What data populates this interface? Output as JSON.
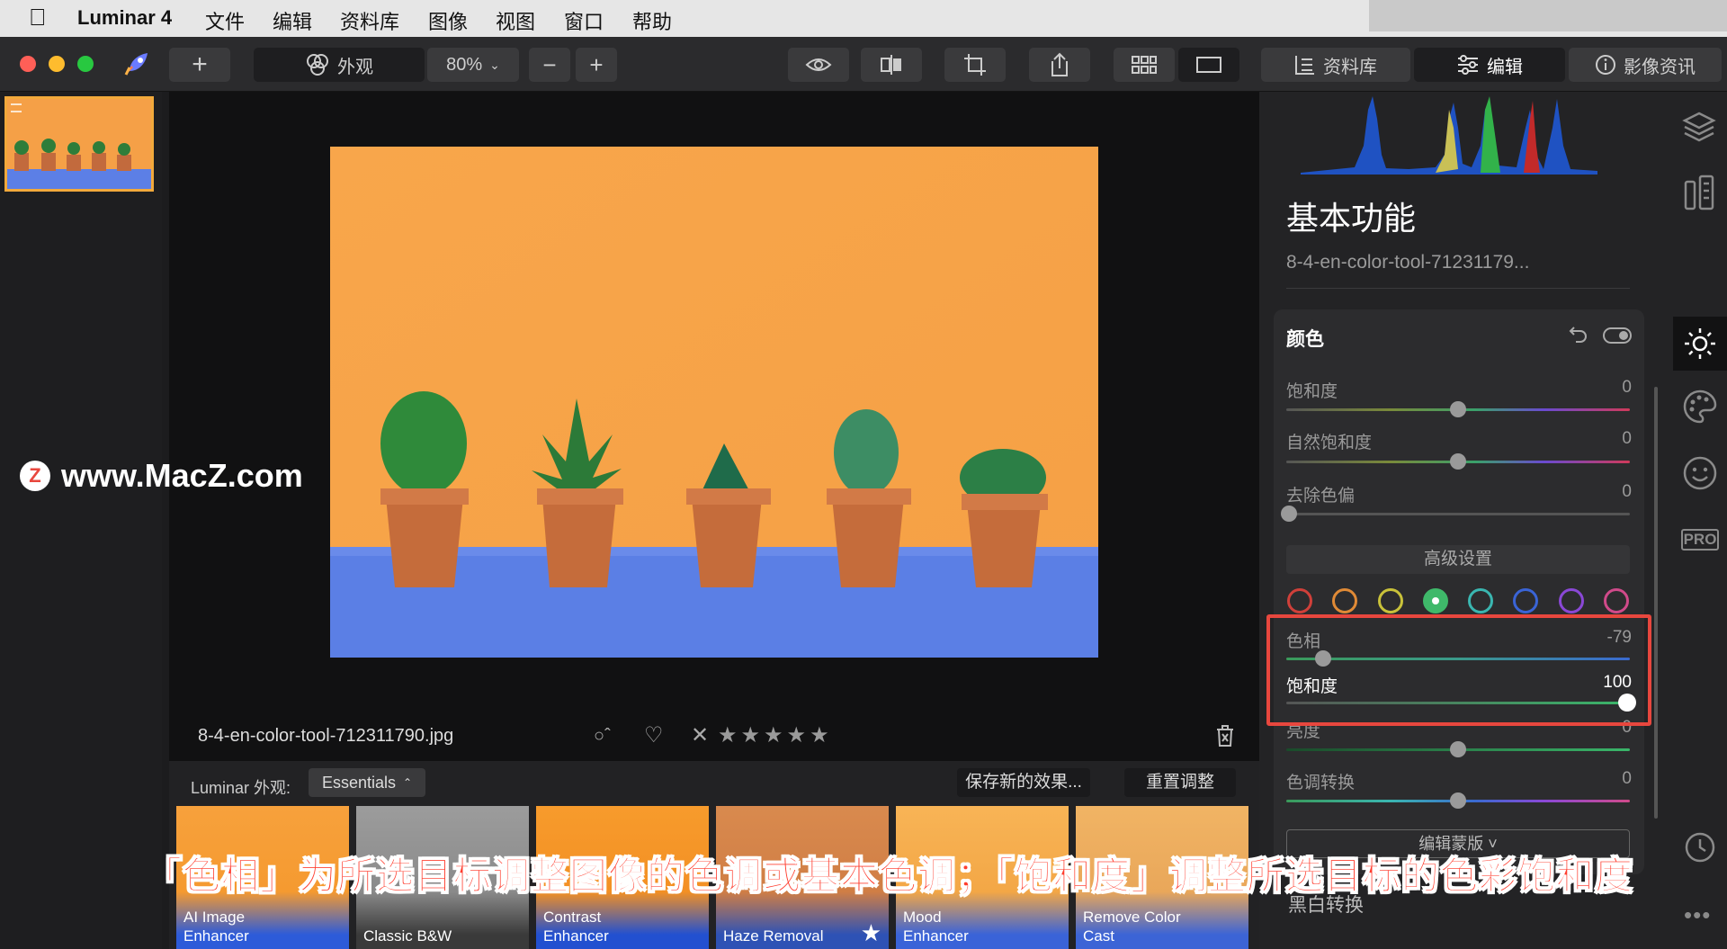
{
  "menubar": {
    "app_name": "Luminar 4",
    "items": [
      "文件",
      "编辑",
      "资料库",
      "图像",
      "视图",
      "窗口",
      "帮助"
    ]
  },
  "toolbar": {
    "add_label": "+",
    "looks_label": "外观",
    "zoom_label": "80%",
    "zoom_out_label": "−",
    "zoom_in_label": "+",
    "tab_library": "资料库",
    "tab_edit": "编辑",
    "tab_info": "影像资讯"
  },
  "panel": {
    "title": "基本功能",
    "filename": "8-4-en-color-tool-71231179...",
    "section_title": "颜色",
    "sliders": [
      {
        "label": "饱和度",
        "value": "0"
      },
      {
        "label": "自然饱和度",
        "value": "0"
      },
      {
        "label": "去除色偏",
        "value": "0"
      }
    ],
    "advanced_button": "高级设置",
    "hue_label": "色相",
    "hue_value": "-79",
    "sat_label": "饱和度",
    "sat_value": "100",
    "lum_label": "亮度",
    "lum_value": "0",
    "tone_label": "色调转换",
    "tone_value": "0",
    "mask_button": "编辑蒙版 ˅",
    "bw_label": "黑白转换",
    "right_pro_label": "PRO"
  },
  "infobar": {
    "filename": "8-4-en-color-tool-712311790.jpg"
  },
  "looks": {
    "label": "Luminar 外观:",
    "dropdown": "Essentials",
    "save_button": "保存新的效果...",
    "reset_button": "重置调整",
    "tiles": [
      {
        "line1": "AI Image",
        "line2": "Enhancer"
      },
      {
        "line1": "",
        "line2": "Classic B&W"
      },
      {
        "line1": "Contrast",
        "line2": "Enhancer"
      },
      {
        "line1": "",
        "line2": "Haze Removal"
      },
      {
        "line1": "Mood",
        "line2": "Enhancer"
      },
      {
        "line1": "Remove Color",
        "line2": "Cast"
      }
    ]
  },
  "caption": "「色相」为所选目标调整图像的色调或基本色调；「饱和度」调整所选目标的色彩饱和度",
  "watermark": "www.MacZ.com",
  "colors": {
    "accent_red": "#e8473e",
    "photo_orange": "#f7a348",
    "table_blue": "#5c7fe6",
    "selected_hue": "#3fb96a"
  }
}
